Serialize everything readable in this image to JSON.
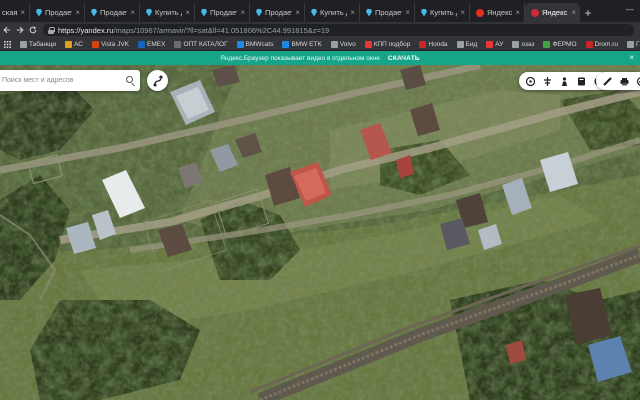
{
  "browser": {
    "tabs": [
      {
        "title": "ская за к",
        "icon": "tab-fragment",
        "active": false
      },
      {
        "title": "Продается",
        "icon": "map-pin-icon",
        "active": false
      },
      {
        "title": "Продается",
        "icon": "map-pin-icon",
        "active": false
      },
      {
        "title": "Купить дом",
        "icon": "map-pin-icon",
        "active": false
      },
      {
        "title": "Продается",
        "icon": "map-pin-icon",
        "active": false
      },
      {
        "title": "Продается",
        "icon": "map-pin-icon",
        "active": false
      },
      {
        "title": "Купить дом",
        "icon": "map-pin-icon",
        "active": false
      },
      {
        "title": "Продается",
        "icon": "map-pin-icon",
        "active": false
      },
      {
        "title": "Купить дом",
        "icon": "map-pin-icon",
        "active": false
      },
      {
        "title": "Яндекс.Кар",
        "icon": "yandex-icon",
        "active": false
      },
      {
        "title": "Яндекс.Кар",
        "icon": "yandex-icon",
        "active": true
      }
    ],
    "new_tab_label": "+",
    "window_controls": "—",
    "address": {
      "host": "https://yandex.ru",
      "path": "/maps/10967/armavir/?ll=sat&ll=41.051806%2C44.991815&z=19"
    },
    "bookmarks": [
      {
        "label": "Табанщи",
        "color": "#9aa0a6"
      },
      {
        "label": "АС",
        "color": "#e0a21e"
      },
      {
        "label": "Vista JVK",
        "color": "#d84315"
      },
      {
        "label": "EMEX",
        "color": "#1565c0"
      },
      {
        "label": "ОПТ КАТАЛОГ",
        "color": "#6d6d6d"
      },
      {
        "label": "BMWcats",
        "color": "#1e88e5"
      },
      {
        "label": "BMW ETK",
        "color": "#1e88e5"
      },
      {
        "label": "Volvo",
        "color": "#9aa0a6"
      },
      {
        "label": "КПП подбор",
        "color": "#e53935"
      },
      {
        "label": "Honda",
        "color": "#c62828"
      },
      {
        "label": "Бид",
        "color": "#9aa0a6"
      },
      {
        "label": "АУ",
        "color": "#e53935"
      },
      {
        "label": "озаз",
        "color": "#9aa0a6"
      },
      {
        "label": "ФЕРМО",
        "color": "#43a047"
      },
      {
        "label": "Drom.ru",
        "color": "#c62828"
      },
      {
        "label": "ГРУЗОВИКИНФОРМ",
        "color": "#9aa0a6"
      },
      {
        "label": "101",
        "color": "#c62828"
      }
    ],
    "info_bar": {
      "message": "Яндекс.Браузер показывает видео в отдельном окне",
      "cta": "СКАЧАТЬ",
      "close": "×"
    }
  },
  "map": {
    "search": {
      "placeholder": "Поиск мест и адресов",
      "value": ""
    },
    "controls_left": [
      "layers-icon",
      "traffic-icon",
      "panorama-icon",
      "bookmark-icon",
      "menu-icon"
    ],
    "controls_right": [
      "ruler-icon",
      "print-icon",
      "share-icon"
    ]
  }
}
